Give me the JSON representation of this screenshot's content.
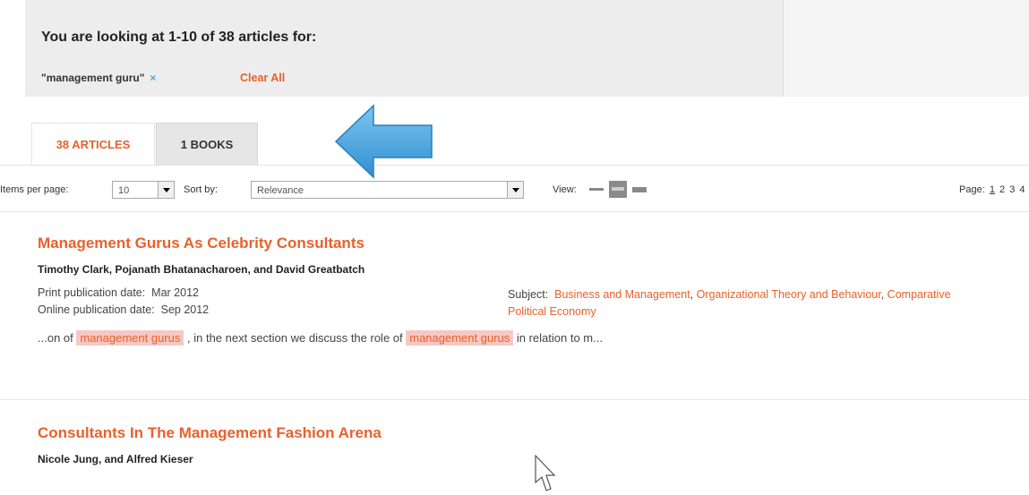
{
  "search_summary": {
    "title": "You are looking at 1-10 of 38 articles for:",
    "filter_term": "\"management guru\"",
    "remove_symbol": "×",
    "clear_all": "Clear All"
  },
  "tabs": {
    "articles": "38 ARTICLES",
    "books": "1 BOOKS"
  },
  "toolbar": {
    "items_per_page_label": "Items per page:",
    "items_per_page_value": "10",
    "sort_by_label": "Sort by:",
    "sort_by_value": "Relevance",
    "view_label": "View:",
    "page_label": "Page:",
    "pages": [
      "1",
      "2",
      "3",
      "4"
    ]
  },
  "results": [
    {
      "title": "Management Gurus As Celebrity Consultants",
      "authors": "Timothy Clark, Pojanath Bhatanacharoen, and David Greatbatch",
      "print_label": "Print publication date:",
      "print_date": "Mar 2012",
      "online_label": "Online publication date:",
      "online_date": "Sep 2012",
      "subject_label": "Subject:",
      "subjects": [
        "Business and Management",
        "Organizational Theory and Behaviour",
        "Comparative Political Economy"
      ],
      "snippet_parts": [
        "...on of ",
        "management gurus",
        " , in the next section we discuss the role of ",
        "management gurus",
        " in relation to m..."
      ]
    },
    {
      "title": "Consultants In The Management Fashion Arena",
      "authors": "Nicole Jung, and Alfred Kieser"
    }
  ],
  "colors": {
    "accent": "#e8612c",
    "highlight_bg": "#f6c8c4",
    "summary_bg": "#ededed",
    "arrow": "#3a9fde"
  }
}
